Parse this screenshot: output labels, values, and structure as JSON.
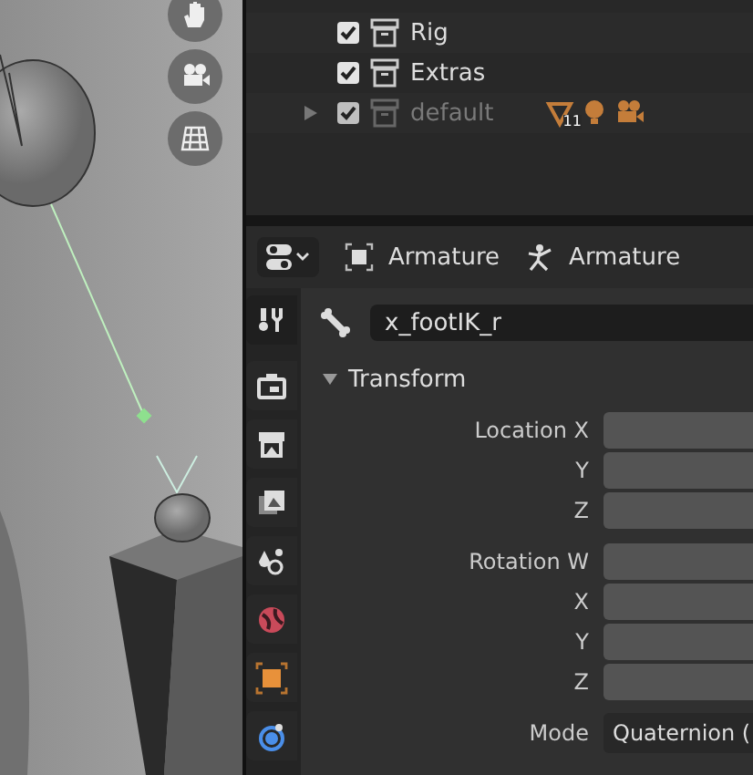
{
  "outliner": {
    "rows": [
      {
        "label": "Rig",
        "checked": true,
        "disabled": false,
        "has_children": false,
        "contents": []
      },
      {
        "label": "Extras",
        "checked": true,
        "disabled": false,
        "has_children": false,
        "contents": []
      },
      {
        "label": "default",
        "checked": true,
        "disabled": true,
        "has_children": true,
        "contents": [
          {
            "kind": "mesh",
            "count": "11"
          },
          {
            "kind": "light"
          },
          {
            "kind": "camera"
          }
        ]
      }
    ]
  },
  "properties": {
    "breadcrumb": [
      {
        "kind": "object",
        "label": "Armature"
      },
      {
        "kind": "armature",
        "label": "Armature"
      }
    ],
    "tabs": [
      {
        "kind": "tool",
        "selected": false
      },
      {
        "kind": "render",
        "selected": false
      },
      {
        "kind": "output",
        "selected": false
      },
      {
        "kind": "view_layer",
        "selected": false
      },
      {
        "kind": "scene",
        "selected": false
      },
      {
        "kind": "world",
        "selected": false
      },
      {
        "kind": "object",
        "selected": false
      },
      {
        "kind": "physics",
        "selected": false
      }
    ],
    "bone_name": {
      "value": "x_footIK_r"
    },
    "panel": {
      "title": "Transform",
      "expanded": true,
      "fields": [
        {
          "kind": "number",
          "label": "Location X"
        },
        {
          "kind": "number",
          "label": "Y"
        },
        {
          "kind": "number",
          "label": "Z"
        },
        {
          "kind": "number",
          "label": "Rotation W",
          "group_start": true
        },
        {
          "kind": "number",
          "label": "X"
        },
        {
          "kind": "number",
          "label": "Y"
        },
        {
          "kind": "number",
          "label": "Z"
        },
        {
          "kind": "dropdown",
          "label": "Mode",
          "value": "Quaternion ("
        }
      ]
    }
  }
}
